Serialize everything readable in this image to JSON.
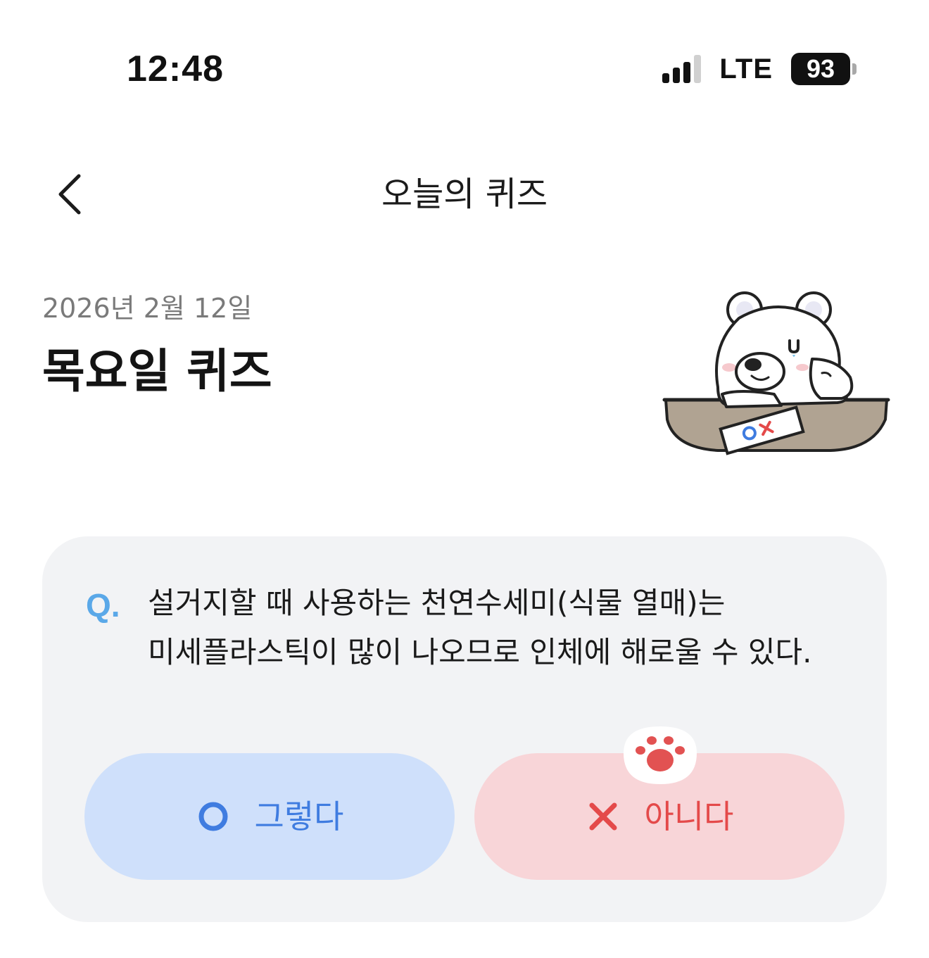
{
  "status_bar": {
    "time": "12:48",
    "network": "LTE",
    "battery": "93"
  },
  "header": {
    "title": "오늘의 퀴즈"
  },
  "quiz": {
    "date": "2026년 2월 12일",
    "heading": "목요일 퀴즈",
    "q_label": "Q.",
    "question_lines": [
      "설거지할 때 사용하는 천연수세미(식물 열매)는",
      "미세플라스틱이 많이 나오므로 인체에 해로울 수 있다."
    ],
    "answer_yes": "그렇다",
    "answer_no": "아니다"
  },
  "colors": {
    "q_accent": "#5aa8e8",
    "yes_bg": "#cfe0fb",
    "yes_fg": "#3f7ce0",
    "no_bg": "#f8d5d8",
    "no_fg": "#e44a4a",
    "card_bg": "#f2f3f5"
  },
  "icons": {
    "back": "chevron-left-icon",
    "yes": "circle-o-icon",
    "no": "x-mark-icon",
    "badge": "paw-icon",
    "illustration": "polar-bear-ox-quiz"
  }
}
